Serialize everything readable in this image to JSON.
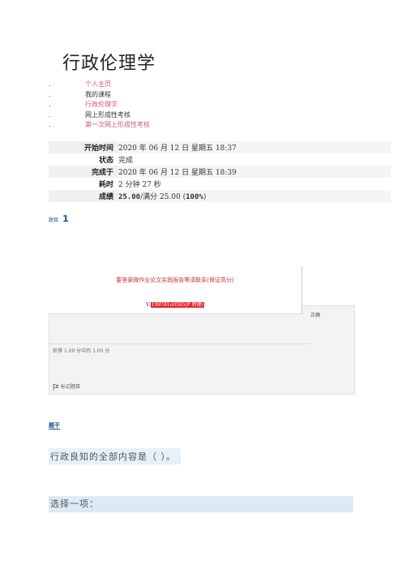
{
  "page": {
    "title": "行政伦理学"
  },
  "breadcrumb": {
    "bullet": ".",
    "items": [
      {
        "label": "个人主页",
        "link": true
      },
      {
        "label": "我的课程",
        "link": false
      },
      {
        "label": "行政伦理学",
        "link": true
      },
      {
        "label": "网上形成性考核",
        "link": false
      },
      {
        "label": "第一次网上形成性考核",
        "link": true
      }
    ]
  },
  "summary": {
    "rows": [
      {
        "label": "开始时间",
        "value": "2020 年 06 月 12 日  星期五  18:37"
      },
      {
        "label": "状态",
        "value": "完成"
      },
      {
        "label": "完成于",
        "value": "2020 年 06 月 12 日  星期五  18:39"
      },
      {
        "label": "耗时",
        "value": "2 分钟  27  秒"
      },
      {
        "label": "成绩",
        "value_bold": "25.00",
        "value_rest": "/满分 25.00 (",
        "value_percent": "100%",
        "value_close": ")"
      }
    ]
  },
  "question": {
    "label": "题目",
    "number": "1",
    "status": "正确",
    "score": "获得 1.00 分中的 1.00 分",
    "flag_label": "标记题目",
    "section_label": "题干",
    "text": "行政良知的全部内容是（    ）。",
    "choose_prompt": "选择一项："
  },
  "ad": {
    "line1": "要答案做作业论文实践报告等请联系(保证高分)",
    "line2_prefix": "V:",
    "line2_highlight": "199781e0505(P 转理)"
  },
  "colors": {
    "link": "#d05a6e",
    "accent_blue": "#1a4d8a",
    "ad_red": "#e8222a",
    "question_bg": "#e6f1f8"
  }
}
